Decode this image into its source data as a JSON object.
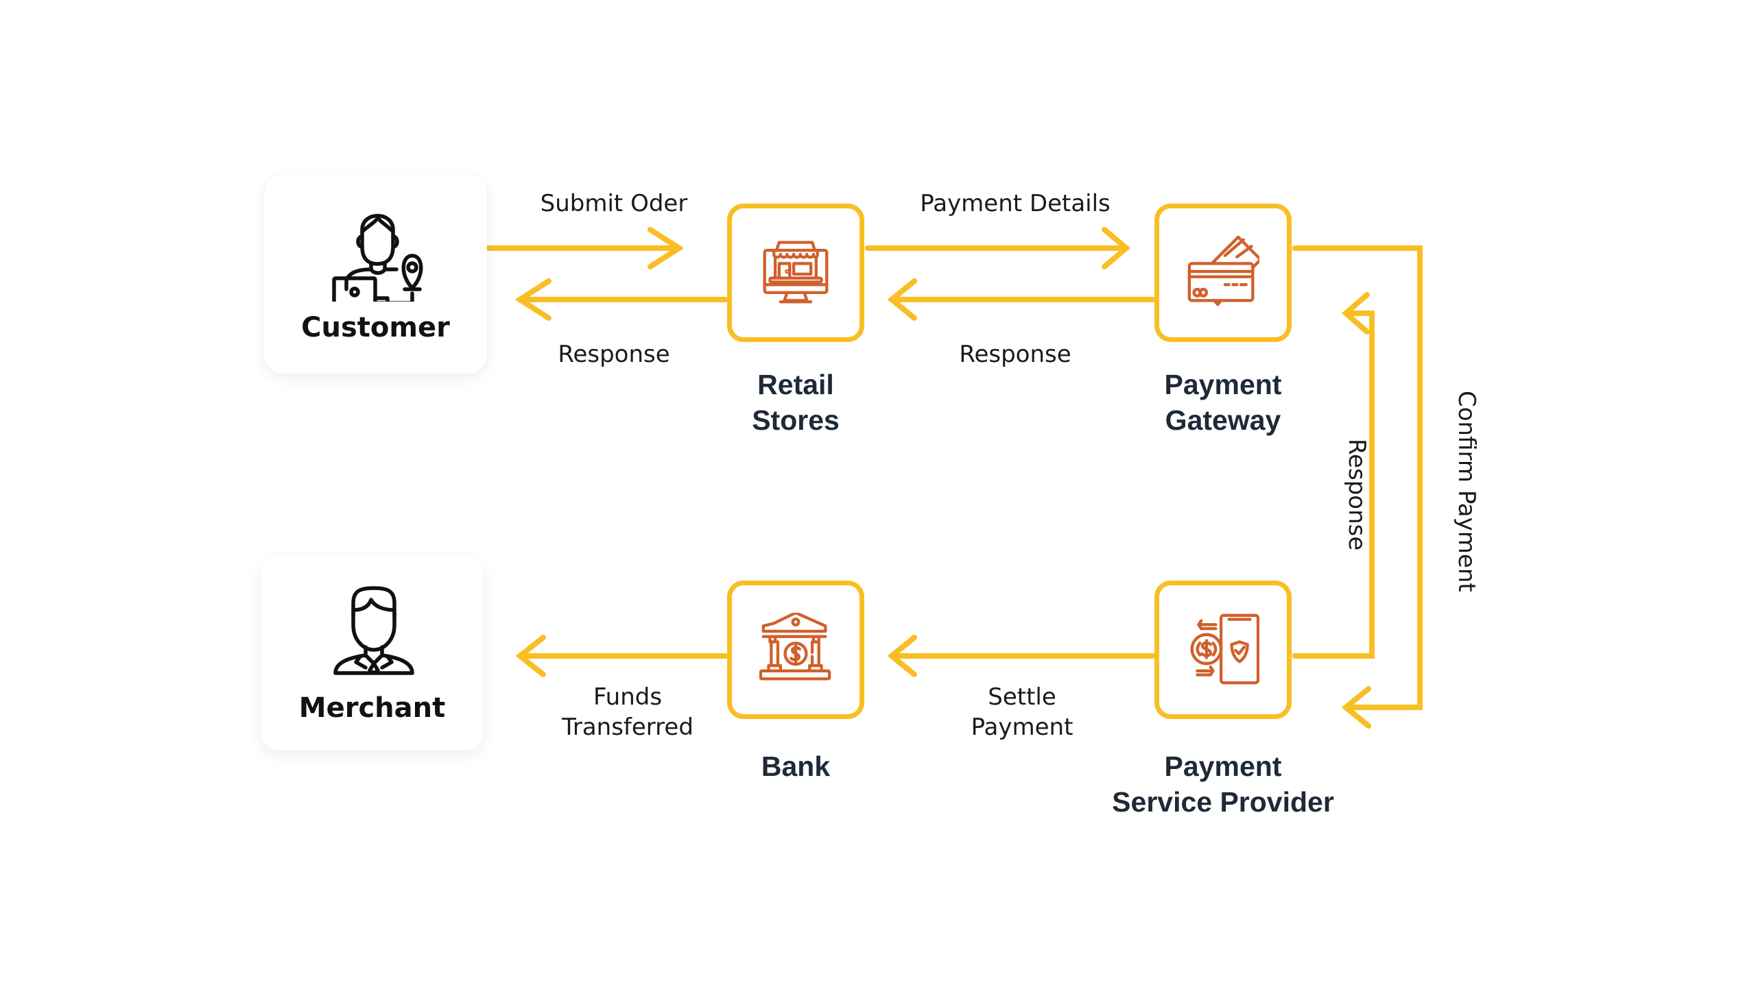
{
  "colors": {
    "arrow": "#F8BE23",
    "icon": "#D0602B",
    "node_label": "#1F2937",
    "actor_icon": "#111111"
  },
  "actors": {
    "customer": {
      "label": "Customer",
      "icon": "customer-laptop-location-icon"
    },
    "merchant": {
      "label": "Merchant",
      "icon": "businessman-icon"
    }
  },
  "nodes": {
    "retail_stores": {
      "label_line1": "Retail",
      "label_line2": "Stores",
      "icon": "online-store-monitor-icon"
    },
    "payment_gateway": {
      "label_line1": "Payment",
      "label_line2": "Gateway",
      "icon": "credit-cards-icon"
    },
    "bank": {
      "label_line1": "Bank",
      "icon": "bank-dollar-icon"
    },
    "payment_service_provider": {
      "label_line1": "Payment",
      "label_line2": "Service Provider",
      "icon": "mobile-payment-transfer-icon"
    }
  },
  "edges": [
    {
      "id": "submit-order",
      "from": "Customer",
      "to": "Retail Stores",
      "label": "Submit Oder"
    },
    {
      "id": "response-retail-customer",
      "from": "Retail Stores",
      "to": "Customer",
      "label": "Response"
    },
    {
      "id": "payment-details",
      "from": "Retail Stores",
      "to": "Payment Gateway",
      "label": "Payment Details"
    },
    {
      "id": "response-gateway-retail",
      "from": "Payment Gateway",
      "to": "Retail Stores",
      "label": "Response"
    },
    {
      "id": "confirm-payment",
      "from": "Payment Gateway",
      "to": "Payment Service Provider",
      "label": "Confirm Payment"
    },
    {
      "id": "response-psp-gateway",
      "from": "Payment Service Provider",
      "to": "Payment Gateway",
      "label": "Response"
    },
    {
      "id": "settle-payment",
      "from": "Payment Service Provider",
      "to": "Bank",
      "label_line1": "Settle",
      "label_line2": "Payment"
    },
    {
      "id": "funds-transferred",
      "from": "Bank",
      "to": "Merchant",
      "label_line1": "Funds",
      "label_line2": "Transferred"
    }
  ]
}
